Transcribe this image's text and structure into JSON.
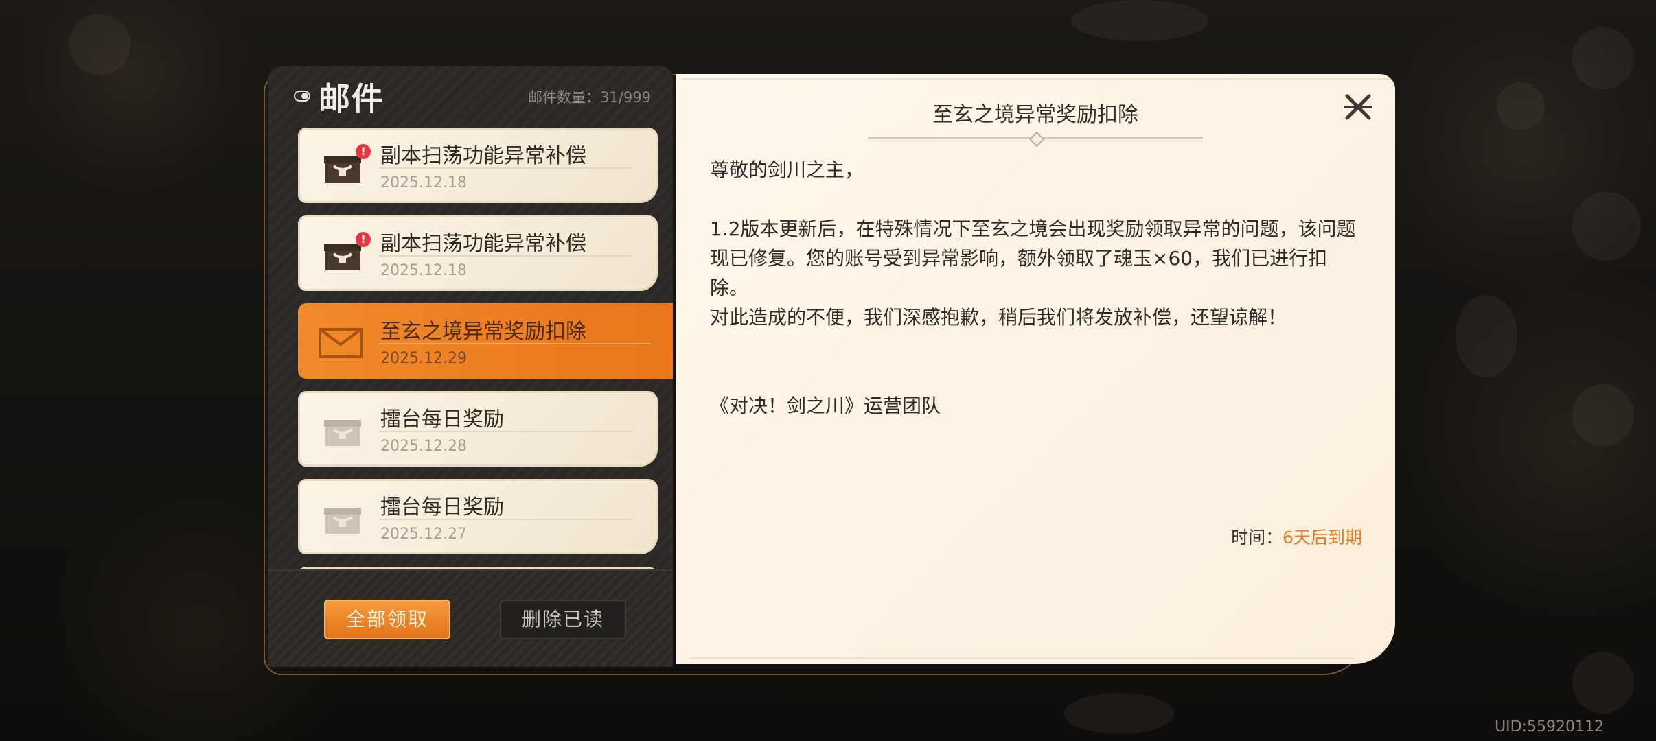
{
  "header": {
    "title": "邮件",
    "mail_count_label": "邮件数量：31/999"
  },
  "mails": [
    {
      "title": "副本扫荡功能异常补偿",
      "date": "2025.12.18",
      "icon": "chest-icon",
      "unread": true
    },
    {
      "title": "副本扫荡功能异常补偿",
      "date": "2025.12.18",
      "icon": "chest-icon",
      "unread": true
    },
    {
      "title": "至玄之境异常奖励扣除",
      "date": "2025.12.29",
      "icon": "envelope-icon",
      "selected": true
    },
    {
      "title": "擂台每日奖励",
      "date": "2025.12.28",
      "icon": "chest-icon",
      "unread": false
    },
    {
      "title": "擂台每日奖励",
      "date": "2025.12.27",
      "icon": "chest-icon",
      "unread": false
    }
  ],
  "badge_text": "!",
  "footer": {
    "claim_all_label": "全部领取",
    "delete_read_label": "删除已读"
  },
  "content": {
    "subject": "至玄之境异常奖励扣除",
    "greeting": "尊敬的剑川之主，",
    "paragraph1": "1.2版本更新后，在特殊情况下至玄之境会出现奖励领取异常的问题，该问题现已修复。您的账号受到异常影响，额外领取了魂玉×60，我们已进行扣除。",
    "paragraph2": "对此造成的不便，我们深感抱歉，稍后我们将发放补偿，还望谅解！",
    "signature": "《对决！剑之川》运营团队",
    "expiry_label": "时间：",
    "expiry_value": "6天后到期"
  },
  "uid": "UID:55920112",
  "colors": {
    "accent": "#e8761c",
    "panel_dark": "#2b2825",
    "paper": "#fbeedc",
    "badge": "#e53843"
  }
}
